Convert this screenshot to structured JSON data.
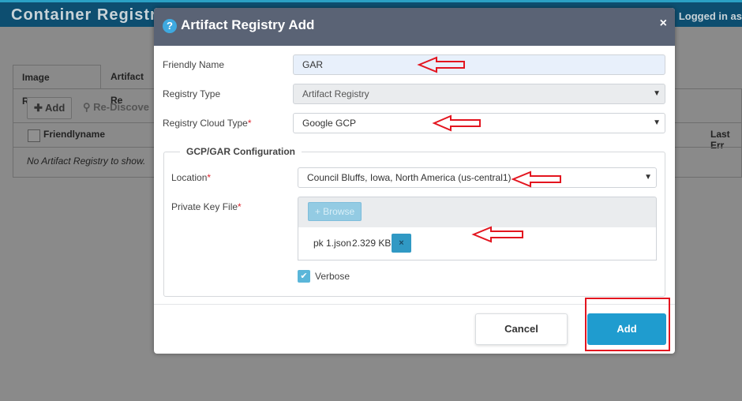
{
  "background": {
    "app_title": "Container Registr",
    "user_text": "Logged in as",
    "tabs": [
      {
        "label": "Image Registries"
      },
      {
        "label": "Artifact Re"
      }
    ],
    "toolbar": {
      "add_label": "Add",
      "rediscover_label": "Re-Discove"
    },
    "table": {
      "columns": [
        "Friendlyname",
        "Last Err"
      ],
      "empty_text": "No Artifact Registry to show."
    }
  },
  "modal": {
    "title": "Artifact Registry Add",
    "help_icon": "?",
    "close_icon": "×",
    "fields": {
      "friendly_name": {
        "label": "Friendly Name",
        "value": "GAR"
      },
      "registry_type": {
        "label": "Registry Type",
        "value": "Artifact Registry"
      },
      "cloud_type": {
        "label": "Registry Cloud Type",
        "required": "*",
        "value": "Google GCP"
      }
    },
    "gcp_section": {
      "legend": "GCP/GAR Configuration",
      "location": {
        "label": "Location",
        "required": "*",
        "value": "Council Bluffs, Iowa, North America (us-central1)"
      },
      "private_key": {
        "label": "Private Key File",
        "required": "*",
        "browse_label": "+ Browse",
        "file_name": "pk 1.json",
        "file_size": "2.329 KB",
        "remove_icon": "×"
      },
      "verbose": {
        "label": "Verbose",
        "checked": true,
        "check_glyph": "✔"
      }
    },
    "footer": {
      "cancel_label": "Cancel",
      "add_label": "Add"
    }
  },
  "colors": {
    "header": "#5a6375",
    "primary": "#1f9ccf",
    "annotation": "#e3151f"
  }
}
